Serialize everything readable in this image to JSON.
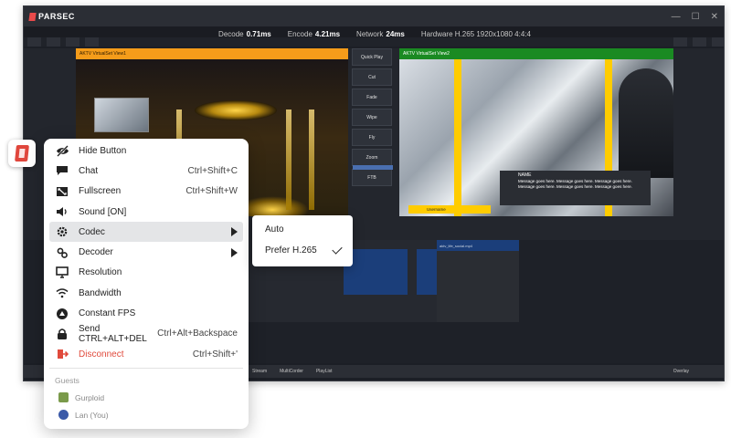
{
  "app": {
    "logo": "PARSEC"
  },
  "stats": {
    "decode_label": "Decode",
    "decode_value": "0.71ms",
    "encode_label": "Encode",
    "encode_value": "4.21ms",
    "network_label": "Network",
    "network_value": "24ms",
    "hardware": "Hardware H.265 1920x1080 4:4:4"
  },
  "preview": {
    "title": "AKTV VirtualSet View1"
  },
  "program": {
    "title": "AKTV VirtualSet View2",
    "name_label": "NAME",
    "message": "Message goes here. Message goes here. Message goes here. Message goes here. Message goes here. Message goes here.",
    "username": "Username"
  },
  "transitions": [
    "Quick Play",
    "Cut",
    "Fade",
    "Wipe",
    "Fly",
    "Zoom",
    "FTB"
  ],
  "toolbar": {
    "stream": "Stream",
    "multicorder": "MultiCorder",
    "playlist": "PlayList",
    "overlay": "Overlay"
  },
  "playlist": {
    "title": "aktv_life_social.mp4"
  },
  "menu": {
    "items": [
      {
        "label": "Hide Button",
        "shortcut": "",
        "icon": "eye-slash-icon"
      },
      {
        "label": "Chat",
        "shortcut": "Ctrl+Shift+C",
        "icon": "chat-icon"
      },
      {
        "label": "Fullscreen",
        "shortcut": "Ctrl+Shift+W",
        "icon": "fullscreen-icon"
      },
      {
        "label": "Sound [ON]",
        "shortcut": "",
        "icon": "speaker-icon"
      },
      {
        "label": "Codec",
        "shortcut": "",
        "icon": "codec-gear-icon"
      },
      {
        "label": "Decoder",
        "shortcut": "",
        "icon": "decoder-icon"
      },
      {
        "label": "Resolution",
        "shortcut": "",
        "icon": "monitor-icon"
      },
      {
        "label": "Bandwidth",
        "shortcut": "",
        "icon": "wifi-icon"
      },
      {
        "label": "Constant FPS",
        "shortcut": "",
        "icon": "fps-icon"
      },
      {
        "label": "Send CTRL+ALT+DEL",
        "shortcut": "Ctrl+Alt+Backspace",
        "icon": "lock-icon"
      },
      {
        "label": "Disconnect",
        "shortcut": "Ctrl+Shift+'",
        "icon": "disconnect-icon"
      }
    ],
    "guests_heading": "Guests",
    "guests": [
      {
        "name": "Gurploid"
      },
      {
        "name": "Lan (You)"
      }
    ]
  },
  "codec_submenu": {
    "options": [
      {
        "label": "Auto",
        "checked": false
      },
      {
        "label": "Prefer H.265",
        "checked": true
      }
    ]
  },
  "colors": {
    "accent_red": "#e04a3c",
    "preview_orange": "#f59c1a",
    "program_green": "#1a8a22"
  }
}
